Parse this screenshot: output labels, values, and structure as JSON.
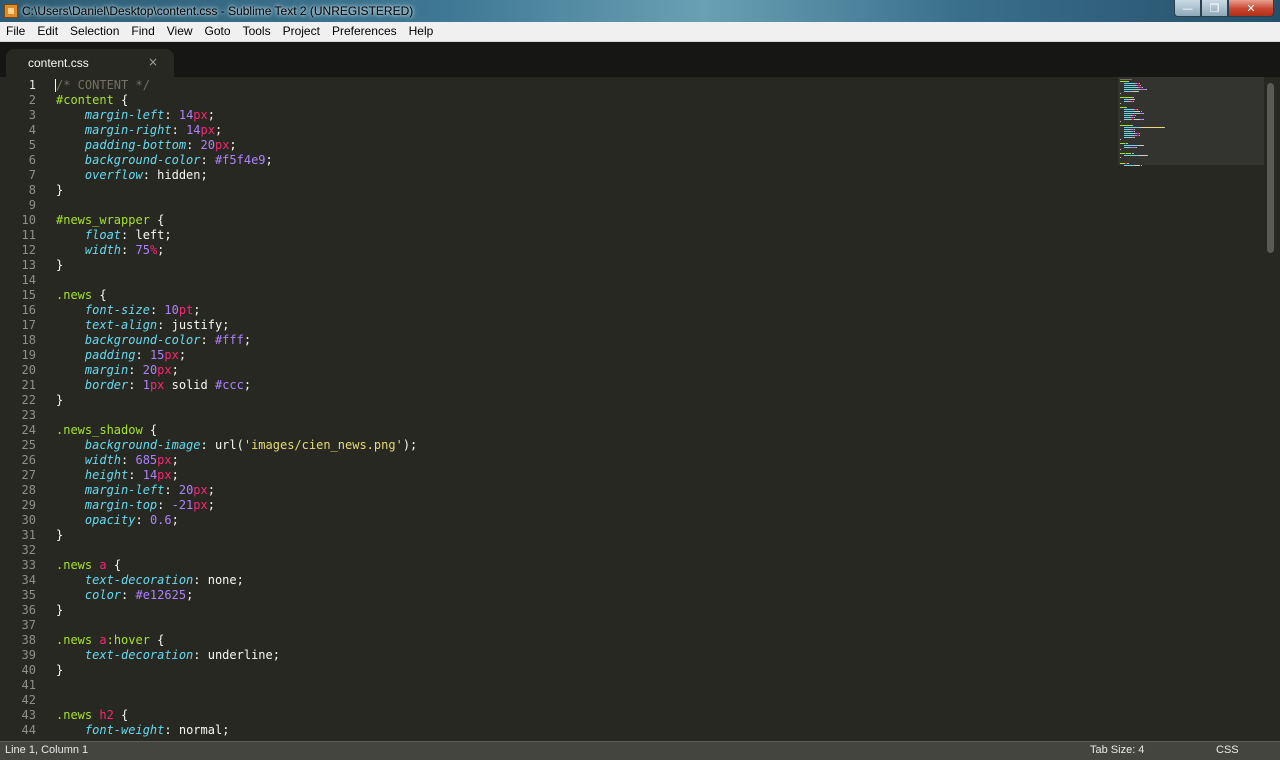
{
  "window": {
    "title": "C:\\Users\\Daniel\\Desktop\\content.css - Sublime Text 2 (UNREGISTERED)",
    "controls": {
      "minimize": "—",
      "maximize": "❐",
      "close": "✕"
    }
  },
  "menu": [
    "File",
    "Edit",
    "Selection",
    "Find",
    "View",
    "Goto",
    "Tools",
    "Project",
    "Preferences",
    "Help"
  ],
  "tab": {
    "label": "content.css",
    "close": "×"
  },
  "editor": {
    "current_line": 1,
    "lines": [
      [
        [
          "c",
          "/* CONTENT */"
        ]
      ],
      [
        [
          "s",
          "#content"
        ],
        [
          "p",
          " {"
        ]
      ],
      [
        [
          "p",
          "    "
        ],
        [
          "k",
          "margin-left"
        ],
        [
          "p",
          ": "
        ],
        [
          "n",
          "14"
        ],
        [
          "u",
          "px"
        ],
        [
          "p",
          ";"
        ]
      ],
      [
        [
          "p",
          "    "
        ],
        [
          "k",
          "margin-right"
        ],
        [
          "p",
          ": "
        ],
        [
          "n",
          "14"
        ],
        [
          "u",
          "px"
        ],
        [
          "p",
          ";"
        ]
      ],
      [
        [
          "p",
          "    "
        ],
        [
          "k",
          "padding-bottom"
        ],
        [
          "p",
          ": "
        ],
        [
          "n",
          "20"
        ],
        [
          "u",
          "px"
        ],
        [
          "p",
          ";"
        ]
      ],
      [
        [
          "p",
          "    "
        ],
        [
          "k",
          "background-color"
        ],
        [
          "p",
          ": "
        ],
        [
          "n",
          "#f5f4e9"
        ],
        [
          "p",
          ";"
        ]
      ],
      [
        [
          "p",
          "    "
        ],
        [
          "k",
          "overflow"
        ],
        [
          "p",
          ": "
        ],
        [
          "v",
          "hidden"
        ],
        [
          "p",
          ";"
        ]
      ],
      [
        [
          "p",
          "}"
        ]
      ],
      [],
      [
        [
          "s",
          "#news_wrapper"
        ],
        [
          "p",
          " {"
        ]
      ],
      [
        [
          "p",
          "    "
        ],
        [
          "k",
          "float"
        ],
        [
          "p",
          ": "
        ],
        [
          "v",
          "left"
        ],
        [
          "p",
          ";"
        ]
      ],
      [
        [
          "p",
          "    "
        ],
        [
          "k",
          "width"
        ],
        [
          "p",
          ": "
        ],
        [
          "n",
          "75"
        ],
        [
          "u",
          "%"
        ],
        [
          "p",
          ";"
        ]
      ],
      [
        [
          "p",
          "}"
        ]
      ],
      [],
      [
        [
          "s",
          ".news"
        ],
        [
          "p",
          " {"
        ]
      ],
      [
        [
          "p",
          "    "
        ],
        [
          "k",
          "font-size"
        ],
        [
          "p",
          ": "
        ],
        [
          "n",
          "10"
        ],
        [
          "u",
          "pt"
        ],
        [
          "p",
          ";"
        ]
      ],
      [
        [
          "p",
          "    "
        ],
        [
          "k",
          "text-align"
        ],
        [
          "p",
          ": "
        ],
        [
          "v",
          "justify"
        ],
        [
          "p",
          ";"
        ]
      ],
      [
        [
          "p",
          "    "
        ],
        [
          "k",
          "background-color"
        ],
        [
          "p",
          ": "
        ],
        [
          "n",
          "#fff"
        ],
        [
          "p",
          ";"
        ]
      ],
      [
        [
          "p",
          "    "
        ],
        [
          "k",
          "padding"
        ],
        [
          "p",
          ": "
        ],
        [
          "n",
          "15"
        ],
        [
          "u",
          "px"
        ],
        [
          "p",
          ";"
        ]
      ],
      [
        [
          "p",
          "    "
        ],
        [
          "k",
          "margin"
        ],
        [
          "p",
          ": "
        ],
        [
          "n",
          "20"
        ],
        [
          "u",
          "px"
        ],
        [
          "p",
          ";"
        ]
      ],
      [
        [
          "p",
          "    "
        ],
        [
          "k",
          "border"
        ],
        [
          "p",
          ": "
        ],
        [
          "n",
          "1"
        ],
        [
          "u",
          "px"
        ],
        [
          "v",
          " solid "
        ],
        [
          "n",
          "#ccc"
        ],
        [
          "p",
          ";"
        ]
      ],
      [
        [
          "p",
          "}"
        ]
      ],
      [],
      [
        [
          "s",
          ".news_shadow"
        ],
        [
          "p",
          " {"
        ]
      ],
      [
        [
          "p",
          "    "
        ],
        [
          "k",
          "background-image"
        ],
        [
          "p",
          ": "
        ],
        [
          "v",
          "url("
        ],
        [
          "q",
          "'images/cien_news.png'"
        ],
        [
          "v",
          ")"
        ],
        [
          "p",
          ";"
        ]
      ],
      [
        [
          "p",
          "    "
        ],
        [
          "k",
          "width"
        ],
        [
          "p",
          ": "
        ],
        [
          "n",
          "685"
        ],
        [
          "u",
          "px"
        ],
        [
          "p",
          ";"
        ]
      ],
      [
        [
          "p",
          "    "
        ],
        [
          "k",
          "height"
        ],
        [
          "p",
          ": "
        ],
        [
          "n",
          "14"
        ],
        [
          "u",
          "px"
        ],
        [
          "p",
          ";"
        ]
      ],
      [
        [
          "p",
          "    "
        ],
        [
          "k",
          "margin-left"
        ],
        [
          "p",
          ": "
        ],
        [
          "n",
          "20"
        ],
        [
          "u",
          "px"
        ],
        [
          "p",
          ";"
        ]
      ],
      [
        [
          "p",
          "    "
        ],
        [
          "k",
          "margin-top"
        ],
        [
          "p",
          ": "
        ],
        [
          "n",
          "-21"
        ],
        [
          "u",
          "px"
        ],
        [
          "p",
          ";"
        ]
      ],
      [
        [
          "p",
          "    "
        ],
        [
          "k",
          "opacity"
        ],
        [
          "p",
          ": "
        ],
        [
          "n",
          "0.6"
        ],
        [
          "p",
          ";"
        ]
      ],
      [
        [
          "p",
          "}"
        ]
      ],
      [],
      [
        [
          "s",
          ".news "
        ],
        [
          "t",
          "a"
        ],
        [
          "p",
          " {"
        ]
      ],
      [
        [
          "p",
          "    "
        ],
        [
          "k",
          "text-decoration"
        ],
        [
          "p",
          ": "
        ],
        [
          "v",
          "none"
        ],
        [
          "p",
          ";"
        ]
      ],
      [
        [
          "p",
          "    "
        ],
        [
          "k",
          "color"
        ],
        [
          "p",
          ": "
        ],
        [
          "n",
          "#e12625"
        ],
        [
          "p",
          ";"
        ]
      ],
      [
        [
          "p",
          "}"
        ]
      ],
      [],
      [
        [
          "s",
          ".news "
        ],
        [
          "t",
          "a"
        ],
        [
          "s",
          ":hover"
        ],
        [
          "p",
          " {"
        ]
      ],
      [
        [
          "p",
          "    "
        ],
        [
          "k",
          "text-decoration"
        ],
        [
          "p",
          ": "
        ],
        [
          "v",
          "underline"
        ],
        [
          "p",
          ";"
        ]
      ],
      [
        [
          "p",
          "}"
        ]
      ],
      [],
      [],
      [
        [
          "s",
          ".news "
        ],
        [
          "t",
          "h2"
        ],
        [
          "p",
          " {"
        ]
      ],
      [
        [
          "p",
          "    "
        ],
        [
          "k",
          "font-weight"
        ],
        [
          "p",
          ": "
        ],
        [
          "v",
          "normal"
        ],
        [
          "p",
          ";"
        ]
      ]
    ]
  },
  "status": {
    "position": "Line 1, Column 1",
    "tab_size": "Tab Size: 4",
    "syntax": "CSS"
  },
  "colors": {
    "background": "#272822",
    "comment": "#75715e",
    "selector": "#a6e22e",
    "tag": "#f92672",
    "property": "#66d9ef",
    "number": "#ae81ff",
    "string": "#e6db74"
  },
  "icons": {
    "app": "sublime-text-icon",
    "tab_close": "close-icon"
  }
}
